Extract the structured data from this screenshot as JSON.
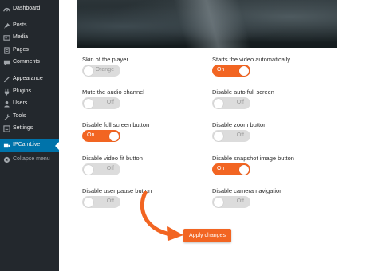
{
  "sidebar": {
    "items": [
      {
        "label": "Dashboard",
        "icon": "dashboard-icon"
      },
      {
        "label": "Posts",
        "icon": "pin-icon"
      },
      {
        "label": "Media",
        "icon": "media-icon"
      },
      {
        "label": "Pages",
        "icon": "page-icon"
      },
      {
        "label": "Comments",
        "icon": "comment-icon"
      },
      {
        "label": "Appearance",
        "icon": "brush-icon"
      },
      {
        "label": "Plugins",
        "icon": "plug-icon"
      },
      {
        "label": "Users",
        "icon": "users-icon"
      },
      {
        "label": "Tools",
        "icon": "wrench-icon"
      },
      {
        "label": "Settings",
        "icon": "settings-icon"
      },
      {
        "label": "IPCamLive",
        "icon": "camera-icon",
        "active": true
      },
      {
        "label": "Collapse menu",
        "icon": "collapse-icon"
      }
    ]
  },
  "options": {
    "left": [
      {
        "label": "Skin of the player",
        "state": "Orange",
        "on": false
      },
      {
        "label": "Mute the audio channel",
        "state": "Off",
        "on": false
      },
      {
        "label": "Disable full screen button",
        "state": "On",
        "on": true
      },
      {
        "label": "Disable video fit button",
        "state": "Off",
        "on": false
      },
      {
        "label": "Disable user pause button",
        "state": "Off",
        "on": false
      }
    ],
    "right": [
      {
        "label": "Starts the video automatically",
        "state": "On",
        "on": true
      },
      {
        "label": "Disable auto full screen",
        "state": "Off",
        "on": false
      },
      {
        "label": "Disable zoom button",
        "state": "Off",
        "on": false
      },
      {
        "label": "Disable snapshot image button",
        "state": "On",
        "on": true
      },
      {
        "label": "Disable camera navigation",
        "state": "Off",
        "on": false
      }
    ]
  },
  "apply_button": {
    "label": "Apply changes"
  },
  "colors": {
    "accent": "#f26522",
    "sidebar_bg": "#23282d",
    "sidebar_active": "#0073aa",
    "toggle_off": "#dcdcdc"
  }
}
